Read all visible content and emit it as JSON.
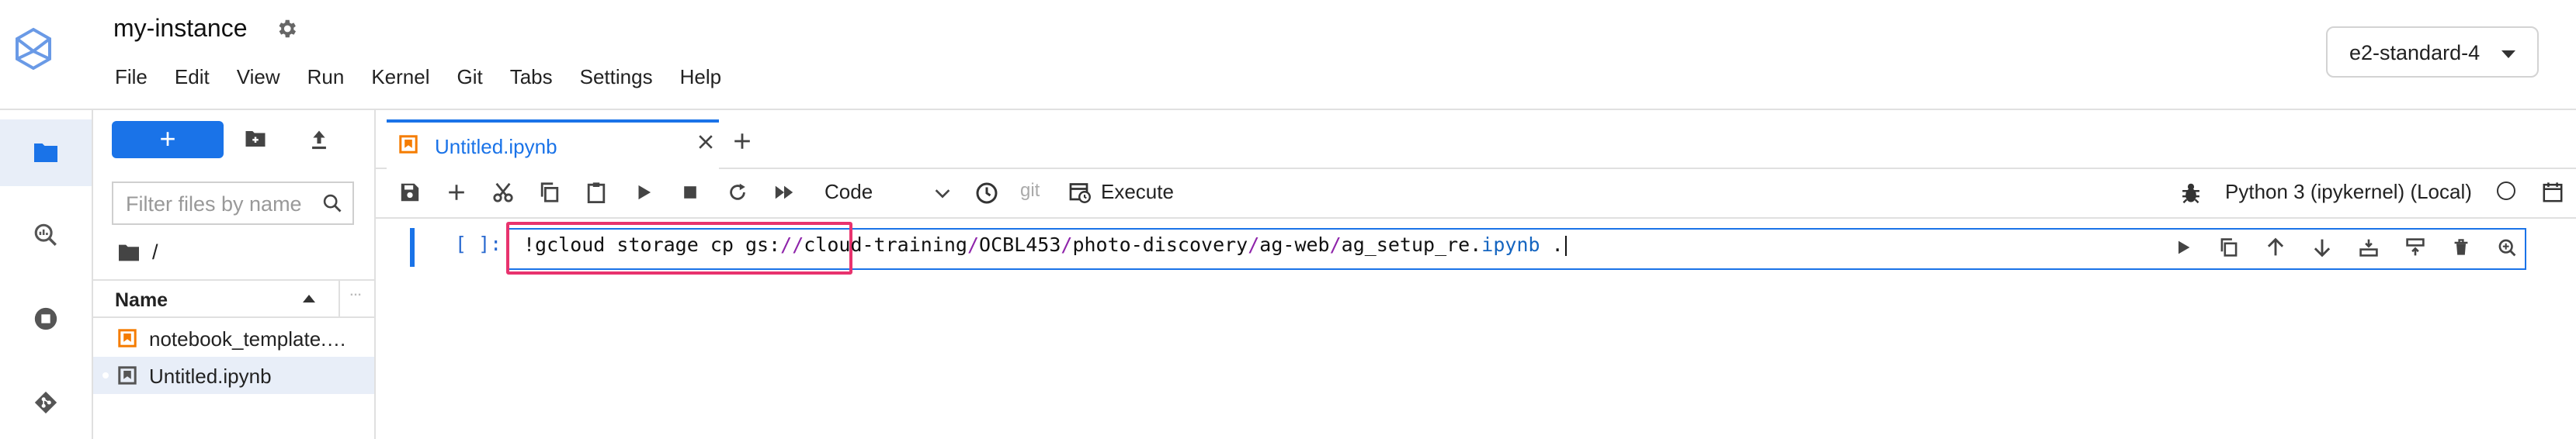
{
  "app": {
    "instance_name": "my-instance",
    "machine_type": "e2-standard-4",
    "menu": [
      "File",
      "Edit",
      "View",
      "Run",
      "Kernel",
      "Git",
      "Tabs",
      "Settings",
      "Help"
    ]
  },
  "file_browser": {
    "new_button_label": "+",
    "filter_placeholder": "Filter files by name",
    "breadcrumb": "/",
    "column_name": "Name",
    "files": [
      {
        "name": "notebook_template.…",
        "selected": false
      },
      {
        "name": "Untitled.ipynb",
        "selected": true
      }
    ]
  },
  "tab": {
    "label": "Untitled.ipynb"
  },
  "toolbar": {
    "cell_type": "Code",
    "git_label": "git",
    "execute_label": "Execute",
    "kernel_label": "Python 3 (ipykernel) (Local)"
  },
  "cell": {
    "prompt": "[ ]:",
    "code_parts": {
      "p1": "!gcloud storage cp gs:",
      "p2": "//",
      "p3": "cloud-training",
      "p4": "/",
      "p5": "OCBL453",
      "p6": "/",
      "p7": "photo-discovery",
      "p8": "/",
      "p9": "ag-web",
      "p10": "/",
      "p11": "ag_setup_re.",
      "p12": "ipynb",
      "p13": " ."
    }
  },
  "colors": {
    "accent": "#1a73e8",
    "highlight": "#e8336e",
    "notebook_icon": "#f57c00"
  }
}
